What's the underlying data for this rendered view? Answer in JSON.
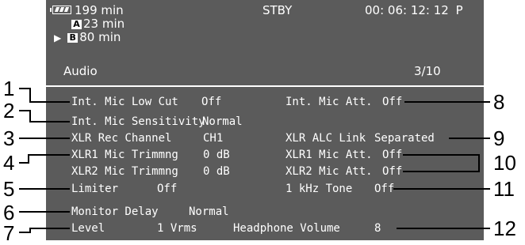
{
  "status": {
    "battery_icon": "battery-full-icon",
    "battery_time": "199 min",
    "mode": "STBY",
    "timecode": "00: 06: 12: 12",
    "timecode_flag": "P",
    "slot_a_letter": "A",
    "slot_a_time": "23 min",
    "slot_b_letter": "B",
    "slot_b_time": "80 min",
    "active_slot_marker": "▶"
  },
  "menu": {
    "title": "Audio",
    "page": "3/10"
  },
  "settings": {
    "int_mic_low_cut_label": "Int.  Mic Low Cut",
    "int_mic_low_cut_value": "Off",
    "int_mic_att_label": "Int.  Mic Att.",
    "int_mic_att_value": "Off",
    "int_mic_sensitivity_label": "Int.  Mic Sensitivity",
    "int_mic_sensitivity_value": "Normal",
    "xlr_rec_channel_label": "XLR Rec Channel",
    "xlr_rec_channel_value": "CH1",
    "xlr_alc_link_label": "XLR ALC Link",
    "xlr_alc_link_value": "Separated",
    "xlr1_trim_label": "XLR1 Mic Trimmng",
    "xlr1_trim_value": "0 dB",
    "xlr1_att_label": "XLR1 Mic Att.",
    "xlr1_att_value": "Off",
    "xlr2_trim_label": "XLR2 Mic Trimmng",
    "xlr2_trim_value": "0 dB",
    "xlr2_att_label": "XLR2 Mic Att.",
    "xlr2_att_value": "Off",
    "limiter_label": "Limiter",
    "limiter_value": "Off",
    "tone_label": "1 kHz Tone",
    "tone_value": "Off",
    "monitor_delay_label": "Monitor Delay",
    "monitor_delay_value": "Normal",
    "level_label": "Level",
    "level_value": "1 Vrms",
    "headphone_label": "Headphone Volume",
    "headphone_value": "8"
  },
  "callouts": [
    "1",
    "2",
    "3",
    "4",
    "5",
    "6",
    "7",
    "8",
    "9",
    "10",
    "11",
    "12"
  ]
}
